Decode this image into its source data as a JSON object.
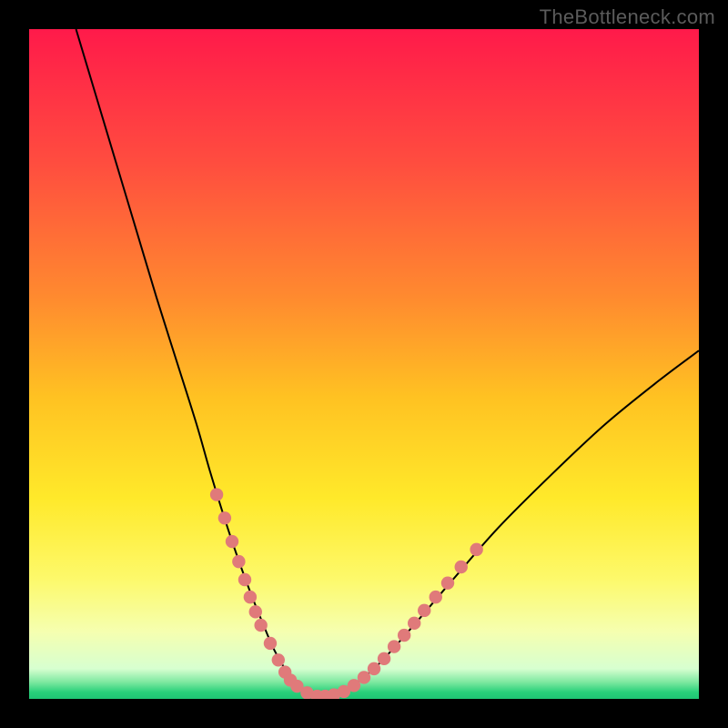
{
  "watermark": "TheBottleneck.com",
  "colors": {
    "frame": "#000000",
    "curve_stroke": "#000000",
    "dots_fill": "#e07a7a",
    "gradient_stops": [
      {
        "offset": 0.0,
        "color": "#ff1a4a"
      },
      {
        "offset": 0.2,
        "color": "#ff4d3f"
      },
      {
        "offset": 0.4,
        "color": "#ff8a2f"
      },
      {
        "offset": 0.55,
        "color": "#ffc222"
      },
      {
        "offset": 0.7,
        "color": "#ffe92a"
      },
      {
        "offset": 0.82,
        "color": "#fdf96a"
      },
      {
        "offset": 0.9,
        "color": "#f5ffb0"
      },
      {
        "offset": 0.955,
        "color": "#d7ffd0"
      },
      {
        "offset": 0.975,
        "color": "#7de8a0"
      },
      {
        "offset": 0.99,
        "color": "#28d07a"
      },
      {
        "offset": 1.0,
        "color": "#1fc574"
      }
    ]
  },
  "chart_data": {
    "type": "line",
    "title": "",
    "xlabel": "",
    "ylabel": "",
    "xlim": [
      0,
      100
    ],
    "ylim": [
      0,
      100
    ],
    "grid": false,
    "legend": false,
    "series": [
      {
        "name": "bottleneck-curve",
        "x": [
          7,
          10,
          13,
          16,
          19,
          22,
          25,
          27,
          29,
          31,
          33,
          35,
          36.5,
          38,
          39.5,
          41,
          43,
          45,
          48,
          52,
          57,
          63,
          70,
          78,
          86,
          94,
          100
        ],
        "y": [
          100,
          90,
          80,
          70,
          60,
          50.5,
          41,
          34,
          27.5,
          21.5,
          16,
          11,
          7.5,
          4.8,
          2.8,
          1.3,
          0.4,
          0.5,
          1.8,
          5,
          10.5,
          17.5,
          25.5,
          33.5,
          41,
          47.5,
          52
        ]
      }
    ],
    "dots": {
      "name": "highlight-dots",
      "points": [
        {
          "x": 28.0,
          "y": 30.5
        },
        {
          "x": 29.2,
          "y": 27.0
        },
        {
          "x": 30.3,
          "y": 23.5
        },
        {
          "x": 31.3,
          "y": 20.5
        },
        {
          "x": 32.2,
          "y": 17.8
        },
        {
          "x": 33.0,
          "y": 15.2
        },
        {
          "x": 33.8,
          "y": 13.0
        },
        {
          "x": 34.6,
          "y": 11.0
        },
        {
          "x": 36.0,
          "y": 8.3
        },
        {
          "x": 37.2,
          "y": 5.8
        },
        {
          "x": 38.2,
          "y": 4.0
        },
        {
          "x": 39.0,
          "y": 2.8
        },
        {
          "x": 40.0,
          "y": 1.9
        },
        {
          "x": 41.5,
          "y": 0.9
        },
        {
          "x": 43.0,
          "y": 0.4
        },
        {
          "x": 44.2,
          "y": 0.4
        },
        {
          "x": 45.5,
          "y": 0.6
        },
        {
          "x": 47.0,
          "y": 1.1
        },
        {
          "x": 48.5,
          "y": 2.0
        },
        {
          "x": 50.0,
          "y": 3.2
        },
        {
          "x": 51.5,
          "y": 4.5
        },
        {
          "x": 53.0,
          "y": 6.0
        },
        {
          "x": 54.5,
          "y": 7.8
        },
        {
          "x": 56.0,
          "y": 9.5
        },
        {
          "x": 57.5,
          "y": 11.3
        },
        {
          "x": 59.0,
          "y": 13.2
        },
        {
          "x": 60.7,
          "y": 15.2
        },
        {
          "x": 62.5,
          "y": 17.3
        },
        {
          "x": 64.5,
          "y": 19.7
        },
        {
          "x": 66.8,
          "y": 22.3
        }
      ]
    }
  }
}
